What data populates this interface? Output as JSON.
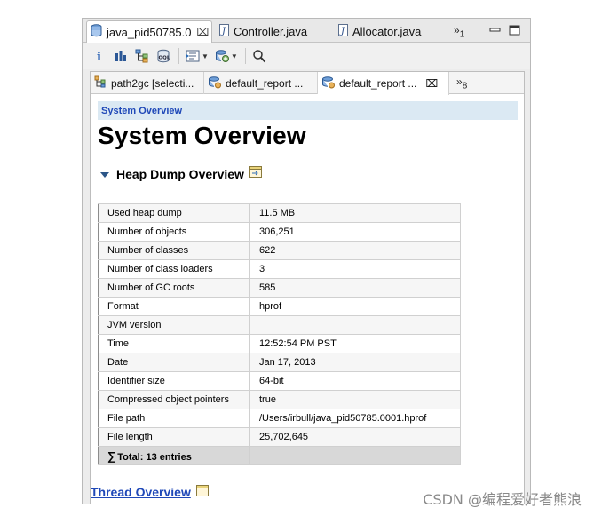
{
  "editor_tabs": [
    {
      "label": "java_pid50785.0",
      "icon": "heap-dump-icon",
      "active": true
    },
    {
      "label": "Controller.java",
      "icon": "java-file-icon",
      "active": false
    },
    {
      "label": "Allocator.java",
      "icon": "java-file-icon",
      "active": false
    }
  ],
  "editor_overflow": {
    "glyph": "»",
    "count": "1"
  },
  "inner_tabs": [
    {
      "label": "path2gc [selecti...",
      "icon": "path-tree-icon"
    },
    {
      "label": "default_report  ...",
      "icon": "report-icon"
    },
    {
      "label": "default_report  ...",
      "icon": "report-icon",
      "active": true
    }
  ],
  "inner_overflow": {
    "glyph": "»",
    "count": "8"
  },
  "breadcrumb": "System Overview",
  "page_title": "System Overview",
  "section_title": "Heap Dump Overview",
  "heap_table": [
    {
      "key": "Used heap dump",
      "value": "11.5 MB"
    },
    {
      "key": "Number of objects",
      "value": "306,251"
    },
    {
      "key": "Number of classes",
      "value": "622"
    },
    {
      "key": "Number of class loaders",
      "value": "3"
    },
    {
      "key": "Number of GC roots",
      "value": "585"
    },
    {
      "key": "Format",
      "value": "hprof"
    },
    {
      "key": "JVM version",
      "value": ""
    },
    {
      "key": "Time",
      "value": "12:52:54 PM PST"
    },
    {
      "key": "Date",
      "value": "Jan 17, 2013"
    },
    {
      "key": "Identifier size",
      "value": "64-bit"
    },
    {
      "key": "Compressed object pointers",
      "value": "true"
    },
    {
      "key": "File path",
      "value": "/Users/irbull/java_pid50785.0001.hprof"
    },
    {
      "key": "File length",
      "value": "25,702,645"
    }
  ],
  "table_total": {
    "glyph": "∑",
    "label": "Total: 13 entries"
  },
  "next_section": "Thread Overview",
  "watermark": "CSDN @编程爱好者熊浪",
  "colors": {
    "link": "#1f48b8",
    "breadcrumb_bg": "#dbe9f3",
    "total_row_bg": "#d8d8d8"
  }
}
